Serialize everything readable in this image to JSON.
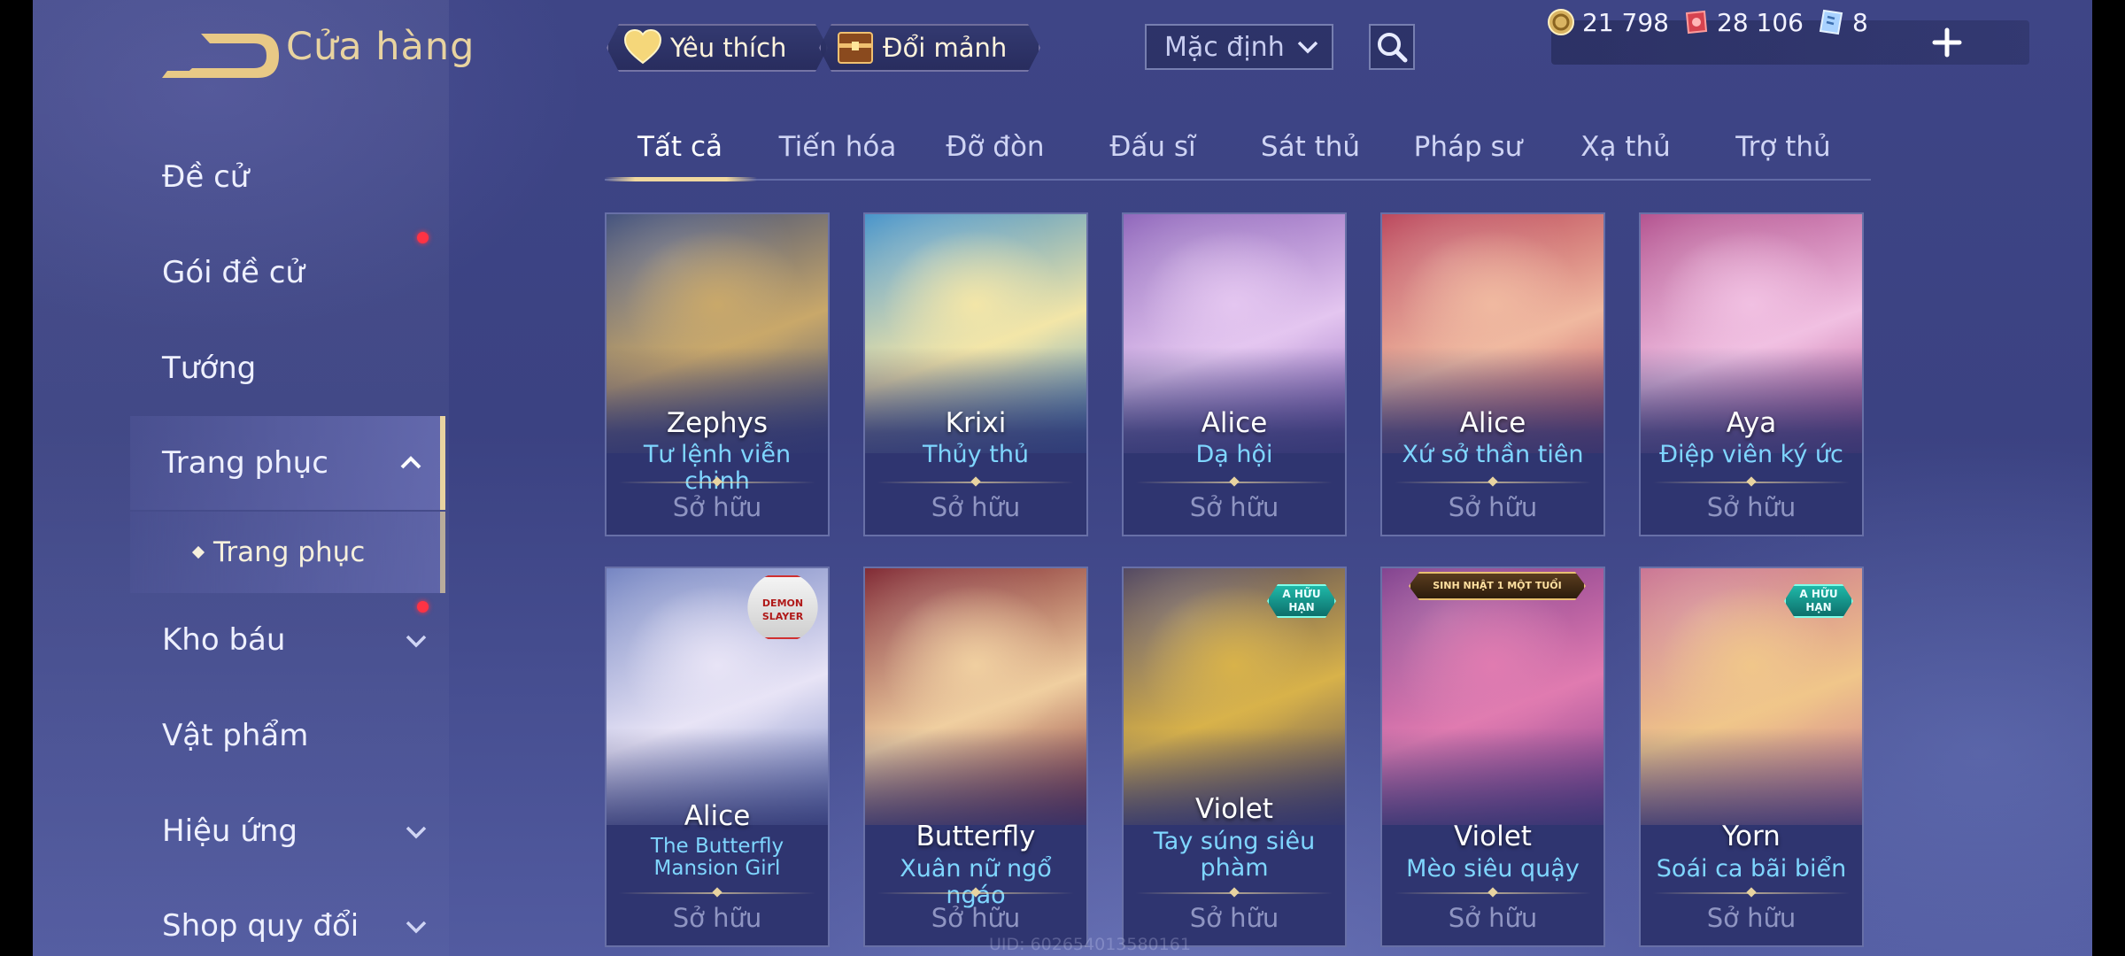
{
  "header": {
    "title": "Cửa hàng",
    "favorites_label": "Yêu thích",
    "exchange_label": "Đổi mảnh",
    "sort_value": "Mặc định"
  },
  "currency": {
    "gold": "21 798",
    "voucher": "28 106",
    "ticket": "8"
  },
  "sidebar": {
    "items": [
      {
        "label": "Đề cử"
      },
      {
        "label": "Gói đề cử"
      },
      {
        "label": "Tướng"
      },
      {
        "label": "Trang phục"
      },
      {
        "label": "Kho báu"
      },
      {
        "label": "Vật phẩm"
      },
      {
        "label": "Hiệu ứng"
      },
      {
        "label": "Shop quy đổi"
      }
    ],
    "sub_item": "Trang phục"
  },
  "tabs": [
    "Tất cả",
    "Tiến hóa",
    "Đỡ đòn",
    "Đấu sĩ",
    "Sát thủ",
    "Pháp sư",
    "Xạ thủ",
    "Trợ thủ"
  ],
  "cards": [
    {
      "hero": "Zephys",
      "skin": "Tư lệnh viễn chinh",
      "status": "Sở hữu",
      "colors": [
        "#3a4a78",
        "#c9a86a"
      ]
    },
    {
      "hero": "Krixi",
      "skin": "Thủy thủ",
      "status": "Sở hữu",
      "colors": [
        "#3f8fc8",
        "#f3e6a8"
      ]
    },
    {
      "hero": "Alice",
      "skin": "Dạ hội",
      "status": "Sở hữu",
      "colors": [
        "#8a5fb8",
        "#e4c6f0"
      ]
    },
    {
      "hero": "Alice",
      "skin": "Xứ sở thần tiên",
      "status": "Sở hữu",
      "colors": [
        "#b83f55",
        "#f0b9a0"
      ]
    },
    {
      "hero": "Aya",
      "skin": "Điệp viên ký ức",
      "status": "Sở hữu",
      "colors": [
        "#b04a8a",
        "#f1c0e2"
      ]
    },
    {
      "hero": "Alice",
      "skin": "The Butterfly Mansion Girl",
      "status": "Sở hữu",
      "colors": [
        "#6e7fbf",
        "#e8e4f6"
      ],
      "badge_text": "DEMON SLAYER"
    },
    {
      "hero": "Butterfly",
      "skin": "Xuân nữ ngổ ngáo",
      "status": "Sở hữu",
      "colors": [
        "#7a1f2a",
        "#f0cfa0"
      ]
    },
    {
      "hero": "Violet",
      "skin": "Tay súng siêu phàm",
      "status": "Sở hữu",
      "colors": [
        "#4a3f5a",
        "#d8b24a"
      ],
      "badge_text": "A HỮU HẠN"
    },
    {
      "hero": "Violet",
      "skin": "Mèo siêu quậy",
      "status": "Sở hữu",
      "colors": [
        "#7c3a8a",
        "#e07bb0"
      ],
      "badge_text": "SINH NHẬT 1 MỘT TUỔI"
    },
    {
      "hero": "Yorn",
      "skin": "Soái ca bãi biển",
      "status": "Sở hữu",
      "colors": [
        "#c86f8f",
        "#f0c68a"
      ],
      "badge_text": "A HỮU HẠN"
    }
  ],
  "uid": "UID: 602654013580161",
  "accent": "#e8d3a0",
  "skin_color": "#7fd6ff"
}
